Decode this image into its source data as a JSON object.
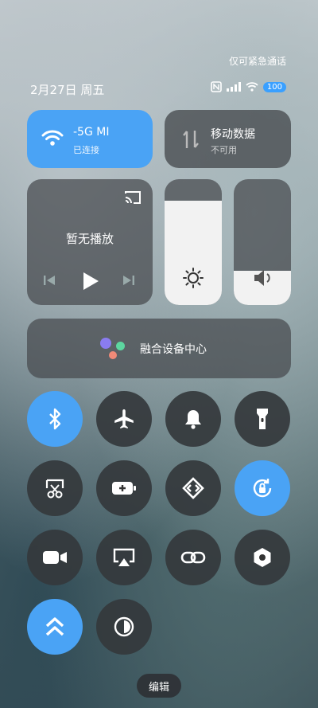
{
  "status_bar": {
    "emergency_note": "仅可紧急通话",
    "date": "2月27日 周五",
    "battery": "100"
  },
  "wifi_tile": {
    "title": "-5G     MI",
    "subtitle": "已连接"
  },
  "mobile_data_tile": {
    "title": "移动数据",
    "subtitle": "不可用"
  },
  "media": {
    "title": "暂无播放"
  },
  "brightness": {
    "level": 0.83
  },
  "volume": {
    "level": 0.27
  },
  "fusion": {
    "label": "融合设备中心"
  },
  "toggles": {
    "row1": [
      "bluetooth-icon",
      "airplane-icon",
      "bell-icon",
      "flashlight-icon"
    ],
    "row2": [
      "screenshot-icon",
      "battery-saver-icon",
      "link-share-icon",
      "rotation-lock-icon"
    ],
    "row3": [
      "video-icon",
      "screen-cast-icon",
      "chain-link-icon",
      "settings-hex-icon"
    ],
    "row4": [
      "double-chevron-up-icon",
      "dark-mode-icon"
    ]
  },
  "edit_button": "编辑",
  "colors": {
    "accent": "#4aa3f5",
    "tile_dark": "#464a4e"
  }
}
